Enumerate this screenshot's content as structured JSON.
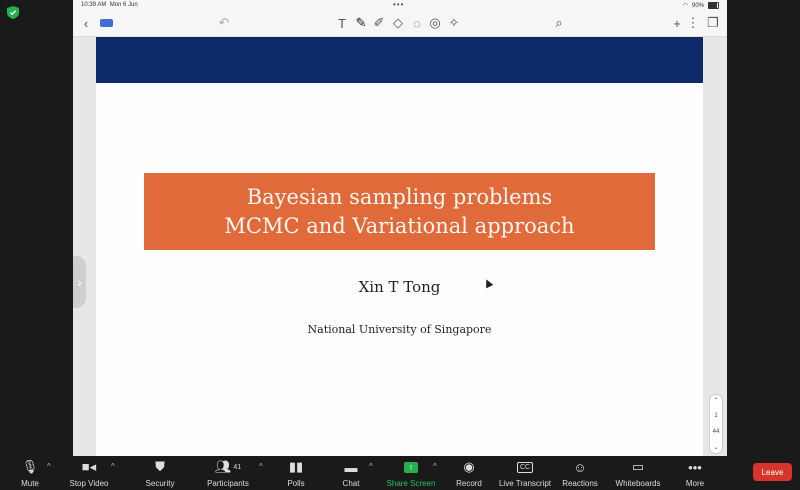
{
  "status_bar": {
    "time": "10:39 AM",
    "date": "Mon 6 Jun",
    "battery": "90%"
  },
  "slide": {
    "title_line1": "Bayesian sampling problems",
    "title_line2": "MCMC and Variational approach",
    "author": "Xin T Tong",
    "institution": "National University of Singapore"
  },
  "pager": {
    "current": "1",
    "total": "44"
  },
  "zoom_toolbar": {
    "mute": "Mute",
    "stop_video": "Stop Video",
    "security": "Security",
    "participants": "Participants",
    "participants_count": "41",
    "polls": "Polls",
    "chat": "Chat",
    "share_screen": "Share Screen",
    "record": "Record",
    "live_transcript": "Live Transcript",
    "reactions": "Reactions",
    "whiteboards": "Whiteboards",
    "more": "More",
    "leave": "Leave"
  },
  "colors": {
    "title_box": "#e06a3a",
    "header_band": "#0d2a6b",
    "share_green": "#22b14c",
    "leave_red": "#d9342b"
  }
}
